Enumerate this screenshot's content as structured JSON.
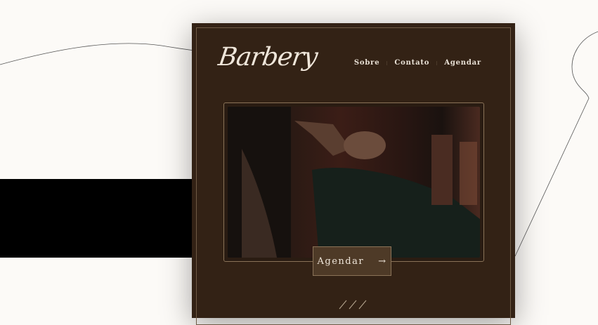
{
  "brand": {
    "logo": "Barbery"
  },
  "nav": {
    "items": [
      {
        "label": "Sobre"
      },
      {
        "label": "Contato"
      },
      {
        "label": "Agendar"
      }
    ]
  },
  "hero": {
    "cta_label": "Agendar",
    "cta_icon": "→"
  },
  "colors": {
    "card": "#332215",
    "button": "#4e3a27",
    "border": "#8a7358",
    "text": "#efe6da"
  }
}
